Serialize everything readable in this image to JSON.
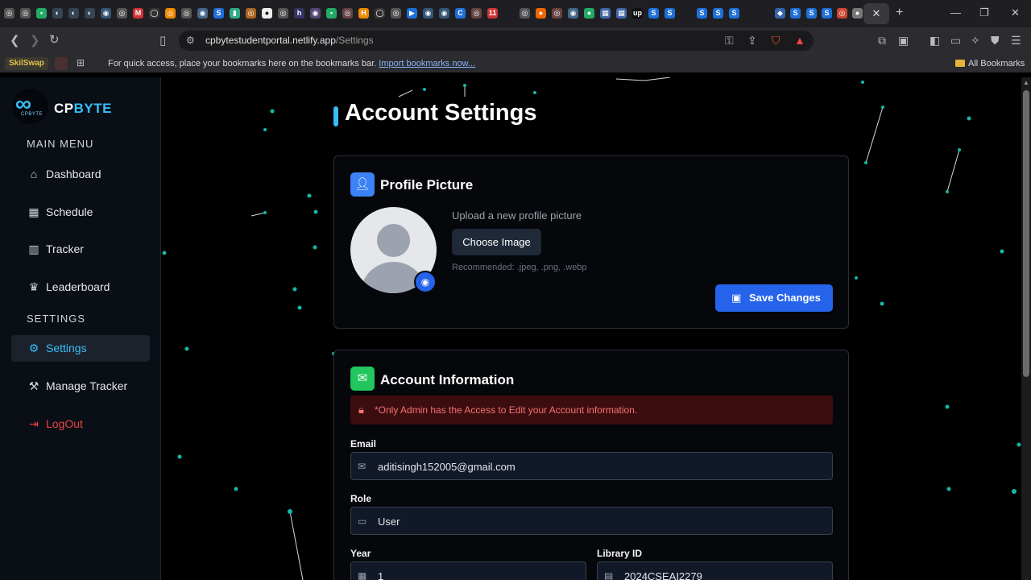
{
  "browser": {
    "url_host": "cpbytestudentportal.netlify.app",
    "url_path": "/Settings",
    "bookmarks_hint": "For quick access, place your bookmarks here on the bookmarks bar.",
    "import_link": "Import bookmarks now...",
    "all_bookmarks": "All Bookmarks",
    "skillswap": "SkilSwap"
  },
  "sidebar": {
    "brand_cp": "CP",
    "brand_byte": "BYTE",
    "logo_sub": "CPBYTE",
    "main_menu": "MAIN MENU",
    "settings_section": "SETTINGS",
    "items": [
      {
        "label": "Dashboard",
        "icon": "home-icon"
      },
      {
        "label": "Schedule",
        "icon": "calendar-icon"
      },
      {
        "label": "Tracker",
        "icon": "bar-chart-icon"
      },
      {
        "label": "Leaderboard",
        "icon": "trophy-icon"
      },
      {
        "label": "Settings",
        "icon": "gear-icon"
      },
      {
        "label": "Manage Tracker",
        "icon": "wrench-icon"
      },
      {
        "label": "LogOut",
        "icon": "logout-icon"
      }
    ]
  },
  "main": {
    "title": "Account Settings",
    "profile": {
      "title": "Profile Picture",
      "upload_label": "Upload a new profile picture",
      "choose_label": "Choose Image",
      "recommended": "Recommended: .jpeg, .png, .webp",
      "save_label": "Save Changes"
    },
    "account": {
      "title": "Account Information",
      "alert": "*Only Admin has the Access to Edit your Account information.",
      "email_label": "Email",
      "email_value": "aditisingh152005@gmail.com",
      "role_label": "Role",
      "role_value": "User",
      "year_label": "Year",
      "year_value": "1",
      "library_label": "Library ID",
      "library_value": "2024CSEAI2279"
    }
  },
  "colors": {
    "accent": "#38bdf8",
    "primary_button": "#2563eb",
    "danger": "#ef4444",
    "profile_icon_bg": "#3b82f6",
    "account_icon_bg": "#22c55e"
  }
}
